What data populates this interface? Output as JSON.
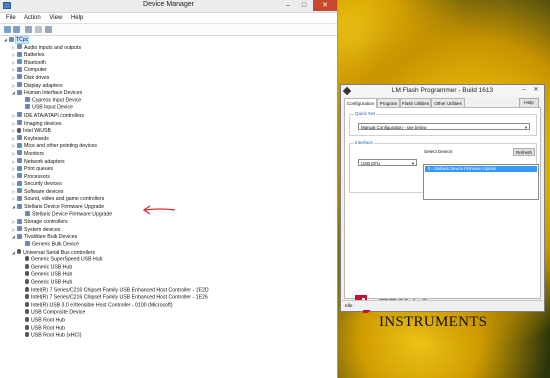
{
  "device_manager": {
    "title": "Device Manager",
    "menu": [
      "File",
      "Action",
      "View",
      "Help"
    ],
    "window_controls": {
      "minimize": "–",
      "maximize": "□",
      "close": "✕"
    },
    "tree": [
      {
        "label": "TCpc",
        "level": 0,
        "expander": "◢",
        "icon": "computer-icon",
        "selected": true
      },
      {
        "label": "Audio inputs and outputs",
        "level": 1,
        "expander": "▷",
        "icon": "speaker-icon"
      },
      {
        "label": "Batteries",
        "level": 1,
        "expander": "▷",
        "icon": "battery-icon"
      },
      {
        "label": "Bluetooth",
        "level": 1,
        "expander": "▷",
        "icon": "bluetooth-icon"
      },
      {
        "label": "Computer",
        "level": 1,
        "expander": "▷",
        "icon": "monitor-icon"
      },
      {
        "label": "Disk drives",
        "level": 1,
        "expander": "▷",
        "icon": "disk-icon"
      },
      {
        "label": "Display adapters",
        "level": 1,
        "expander": "▷",
        "icon": "display-icon"
      },
      {
        "label": "Human Interface Devices",
        "level": 1,
        "expander": "◢",
        "icon": "hid-icon"
      },
      {
        "label": "Cypress Input Device",
        "level": 2,
        "expander": "",
        "icon": "hid-icon"
      },
      {
        "label": "USB Input Device",
        "level": 2,
        "expander": "",
        "icon": "hid-icon"
      },
      {
        "label": "IDE ATA/ATAPI controllers",
        "level": 1,
        "expander": "▷",
        "icon": "ide-icon"
      },
      {
        "label": "Imaging devices",
        "level": 1,
        "expander": "▷",
        "icon": "camera-icon"
      },
      {
        "label": "Intel WiUSB",
        "level": 1,
        "expander": "▷",
        "icon": "usb-icon"
      },
      {
        "label": "Keyboards",
        "level": 1,
        "expander": "▷",
        "icon": "keyboard-icon"
      },
      {
        "label": "Mice and other pointing devices",
        "level": 1,
        "expander": "▷",
        "icon": "mouse-icon"
      },
      {
        "label": "Monitors",
        "level": 1,
        "expander": "▷",
        "icon": "monitor-icon"
      },
      {
        "label": "Network adapters",
        "level": 1,
        "expander": "▷",
        "icon": "network-icon"
      },
      {
        "label": "Print queues",
        "level": 1,
        "expander": "▷",
        "icon": "printer-icon"
      },
      {
        "label": "Processors",
        "level": 1,
        "expander": "▷",
        "icon": "chip-icon"
      },
      {
        "label": "Security devices",
        "level": 1,
        "expander": "▷",
        "icon": "lock-icon"
      },
      {
        "label": "Software devices",
        "level": 1,
        "expander": "▷",
        "icon": "chip-icon"
      },
      {
        "label": "Sound, video and game controllers",
        "level": 1,
        "expander": "▷",
        "icon": "speaker-icon"
      },
      {
        "label": "Stellaris Device Firmware Upgrade",
        "level": 1,
        "expander": "◢",
        "icon": "device-icon"
      },
      {
        "label": "Stellaris Device Firmware Upgrade",
        "level": 2,
        "expander": "",
        "icon": "device-icon"
      },
      {
        "label": "Storage controllers",
        "level": 1,
        "expander": "▷",
        "icon": "storage-icon"
      },
      {
        "label": "System devices",
        "level": 1,
        "expander": "▷",
        "icon": "system-icon"
      },
      {
        "label": "TivaWare Bulk Devices",
        "level": 1,
        "expander": "◢",
        "icon": "device-icon"
      },
      {
        "label": "Generic Bulk Device",
        "level": 2,
        "expander": "",
        "icon": "device-icon"
      },
      {
        "label": "Universal Serial Bus controllers",
        "level": 1,
        "expander": "◢",
        "icon": "usb-icon"
      },
      {
        "label": "Generic SuperSpeed USB Hub",
        "level": 2,
        "expander": "",
        "icon": "usb-icon"
      },
      {
        "label": "Generic USB Hub",
        "level": 2,
        "expander": "",
        "icon": "usb-icon"
      },
      {
        "label": "Generic USB Hub",
        "level": 2,
        "expander": "",
        "icon": "usb-icon"
      },
      {
        "label": "Generic USB Hub",
        "level": 2,
        "expander": "",
        "icon": "usb-icon"
      },
      {
        "label": "Intel(R) 7 Series/C216 Chipset Family USB Enhanced Host Controller - 1E2D",
        "level": 2,
        "expander": "",
        "icon": "usb-icon"
      },
      {
        "label": "Intel(R) 7 Series/C216 Chipset Family USB Enhanced Host Controller - 1E26",
        "level": 2,
        "expander": "",
        "icon": "usb-icon"
      },
      {
        "label": "Intel(R) USB 3.0 eXtensible Host Controller - 0100 (Microsoft)",
        "level": 2,
        "expander": "",
        "icon": "usb-icon"
      },
      {
        "label": "USB Composite Device",
        "level": 2,
        "expander": "",
        "icon": "usb-icon"
      },
      {
        "label": "USB Root Hub",
        "level": 2,
        "expander": "",
        "icon": "usb-icon"
      },
      {
        "label": "USB Root Hub",
        "level": 2,
        "expander": "",
        "icon": "usb-icon"
      },
      {
        "label": "USB Root Hub (xHCI)",
        "level": 2,
        "expander": "",
        "icon": "usb-icon"
      }
    ]
  },
  "lm_flash": {
    "title": "LM Flash Programmer - Build 1613",
    "window_controls": {
      "minimize": "–",
      "close": "✕"
    },
    "tabs": [
      "Configuration",
      "Program",
      "Flash Utilities",
      "Other Utilities"
    ],
    "active_tab": "Configuration",
    "help_label": "Help",
    "quick_set": {
      "label": "Quick Set",
      "value": "Manual Configuration - see below"
    },
    "interface": {
      "label": "Interface",
      "value": "USB DFU",
      "select_device_label": "Select Device:",
      "refresh_label": "Refresh",
      "devices": [
        "0 - Stellaris Device Firmware Update"
      ]
    },
    "brand": "Texas Instruments",
    "brand_display": "TEXAS INSTRUMENTS",
    "status": "Idle"
  },
  "colors": {
    "selection": "#3399ff",
    "annotation_arrow": "#d9302b",
    "ti_red": "#c8102e",
    "group_label": "#1a5fb4"
  }
}
